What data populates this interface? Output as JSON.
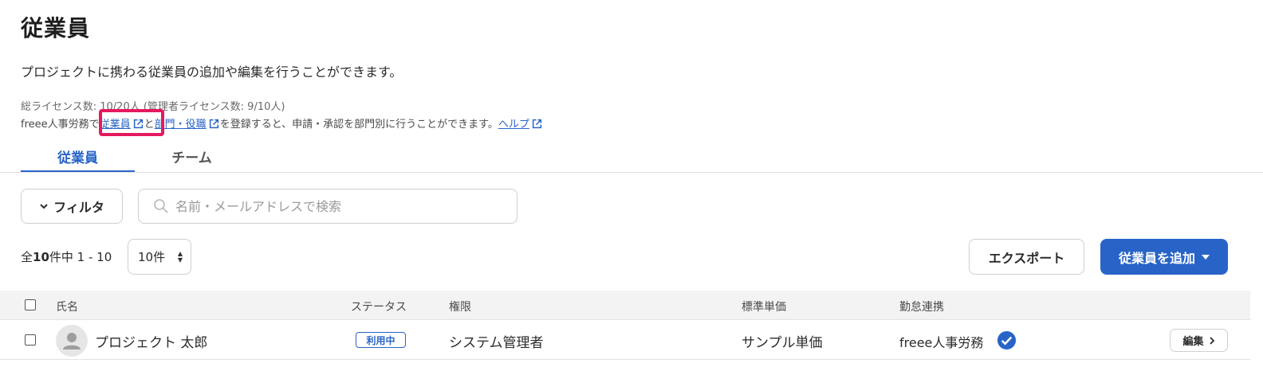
{
  "page": {
    "title": "従業員",
    "description": "プロジェクトに携わる従業員の追加や編集を行うことができます。",
    "license_text": "総ライセンス数: 10/20人 (管理者ライセンス数: 9/10人)",
    "hr_prefix": "freee人事労務で",
    "hr_link_employees": "従業員",
    "hr_middle": "と",
    "hr_link_departments": "部門・役職",
    "hr_suffix": "を登録すると、申請・承認を部門別に行うことができます。",
    "hr_link_help": "ヘルプ"
  },
  "tabs": [
    {
      "label": "従業員",
      "active": true
    },
    {
      "label": "チーム",
      "active": false
    }
  ],
  "toolbar": {
    "filter_label": "フィルタ",
    "search_placeholder": "名前・メールアドレスで検索",
    "search_value": ""
  },
  "pagination": {
    "prefix": "全",
    "total": "10",
    "suffix": "件中 1 - 10",
    "per_page": "10件"
  },
  "actions": {
    "export_label": "エクスポート",
    "add_label": "従業員を追加"
  },
  "table": {
    "headers": {
      "name": "氏名",
      "status": "ステータス",
      "role": "権限",
      "rate": "標準単価",
      "attendance": "勤怠連携"
    },
    "rows": [
      {
        "name": "プロジェクト 太郎",
        "status": "利用中",
        "role": "システム管理者",
        "rate": "サンプル単価",
        "attendance": "freee人事労務",
        "edit_label": "編集"
      }
    ]
  },
  "colors": {
    "accent": "#2864c8",
    "highlight": "#e5195f"
  }
}
